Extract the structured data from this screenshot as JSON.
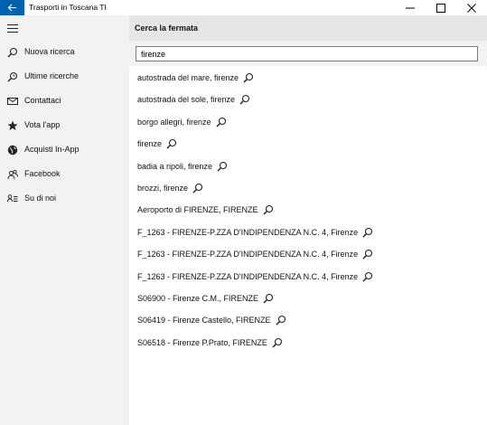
{
  "window": {
    "title": "Trasporti in Toscana TI"
  },
  "sidebar": {
    "items": [
      {
        "label": "Nuova ricerca",
        "icon": "search-icon"
      },
      {
        "label": "Ultime ricerche",
        "icon": "history-icon"
      },
      {
        "label": "Contattaci",
        "icon": "mail-icon"
      },
      {
        "label": "Vota l'app",
        "icon": "star-icon"
      },
      {
        "label": "Acquisti In-App",
        "icon": "globe-icon"
      },
      {
        "label": "Facebook",
        "icon": "people-icon"
      },
      {
        "label": "Su di noi",
        "icon": "contact-info-icon"
      }
    ]
  },
  "main": {
    "title": "Cerca la fermata",
    "search": {
      "value": "firenze"
    },
    "results": [
      {
        "label": "autostrada del mare,  firenze"
      },
      {
        "label": "autostrada del sole,  firenze"
      },
      {
        "label": "borgo allegri,  firenze"
      },
      {
        "label": "firenze"
      },
      {
        "label": "badia a ripoli, firenze"
      },
      {
        "label": "brozzi, firenze"
      },
      {
        "label": "Aeroporto di FIRENZE, FIRENZE"
      },
      {
        "label": "F_1263 - FIRENZE-P.ZZA D'INDIPENDENZA N.C. 4, Firenze"
      },
      {
        "label": "F_1263 - FIRENZE-P.ZZA D'INDIPENDENZA N.C. 4, Firenze"
      },
      {
        "label": "F_1263 - FIRENZE-P.ZZA D'INDIPENDENZA N.C. 4, Firenze"
      },
      {
        "label": "S06900 - Firenze C.M., FIRENZE"
      },
      {
        "label": "S06419 - Firenze Castello, FIRENZE"
      },
      {
        "label": "S06518 - Firenze P.Prato, FIRENZE"
      }
    ]
  },
  "colors": {
    "accent": "#0063b1",
    "sidebar_bg": "#f2f2f2",
    "header_bg": "#e6e6e6"
  }
}
